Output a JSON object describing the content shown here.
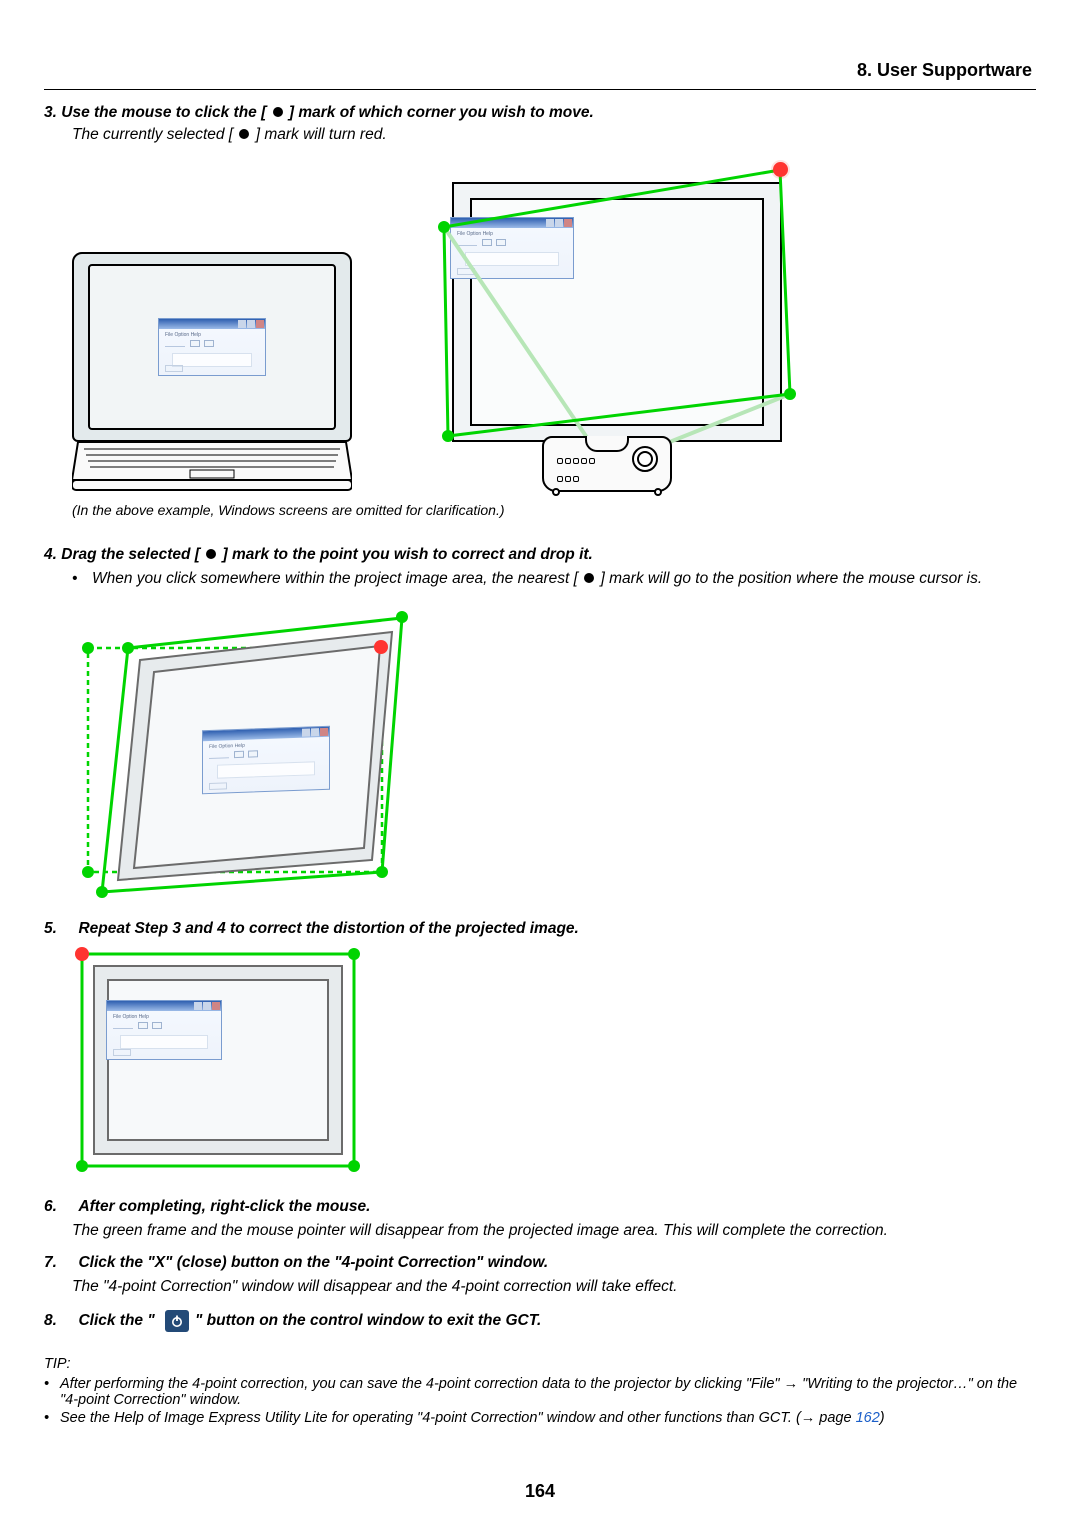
{
  "section_title": "8. User Supportware",
  "step3": {
    "line_a": "3.",
    "line_b_pre": "Use the mouse to click the [ ",
    "line_b_post": " ] mark of which corner you wish to move.",
    "line2_pre": "The currently selected [ ",
    "line2_post": " ] mark will turn red."
  },
  "caption1": "(In the above example, Windows screens are omitted for clarification.)",
  "step4": {
    "title_a": "4.",
    "title_b_pre": "Drag the selected [ ",
    "title_b_post": " ] mark to the point you wish to correct and drop it.",
    "bullet_pre": "When you click somewhere within the project image area, the nearest [ ",
    "bullet_post": " ] mark will go to the position where the mouse cursor is."
  },
  "step5": "5.\tRepeat Step 3 and 4 to correct the distortion of the projected image.",
  "step6": {
    "title": "6.\tAfter completing, right-click the mouse.",
    "body": "The green frame and the mouse pointer will disappear from the projected image area. This will complete the correction."
  },
  "step7": {
    "title": "7.\tClick the \"X\" (close) button on the \"4-point Correction\" window.",
    "body": "The \"4-point Correction\" window will disappear and the 4-point correction will take effect."
  },
  "step8": {
    "pre": "8.\tClick the \" ",
    "post": " \" button on the control window to exit the GCT."
  },
  "tip_label": "TIP:",
  "tip1": "After performing the 4-point correction, you can save the 4-point correction data to the projector by clicking \"File\" → \"Writing to the projector…\" on the \"4-point Correction\" window.",
  "tip2_pre": "See the Help of Image Express Utility Lite for operating \"4-point Correction\" window and other functions than GCT. (→ page ",
  "tip2_link": "162",
  "tip2_post": ")",
  "page_number": "164",
  "mini_menu": "File  Option  Help"
}
